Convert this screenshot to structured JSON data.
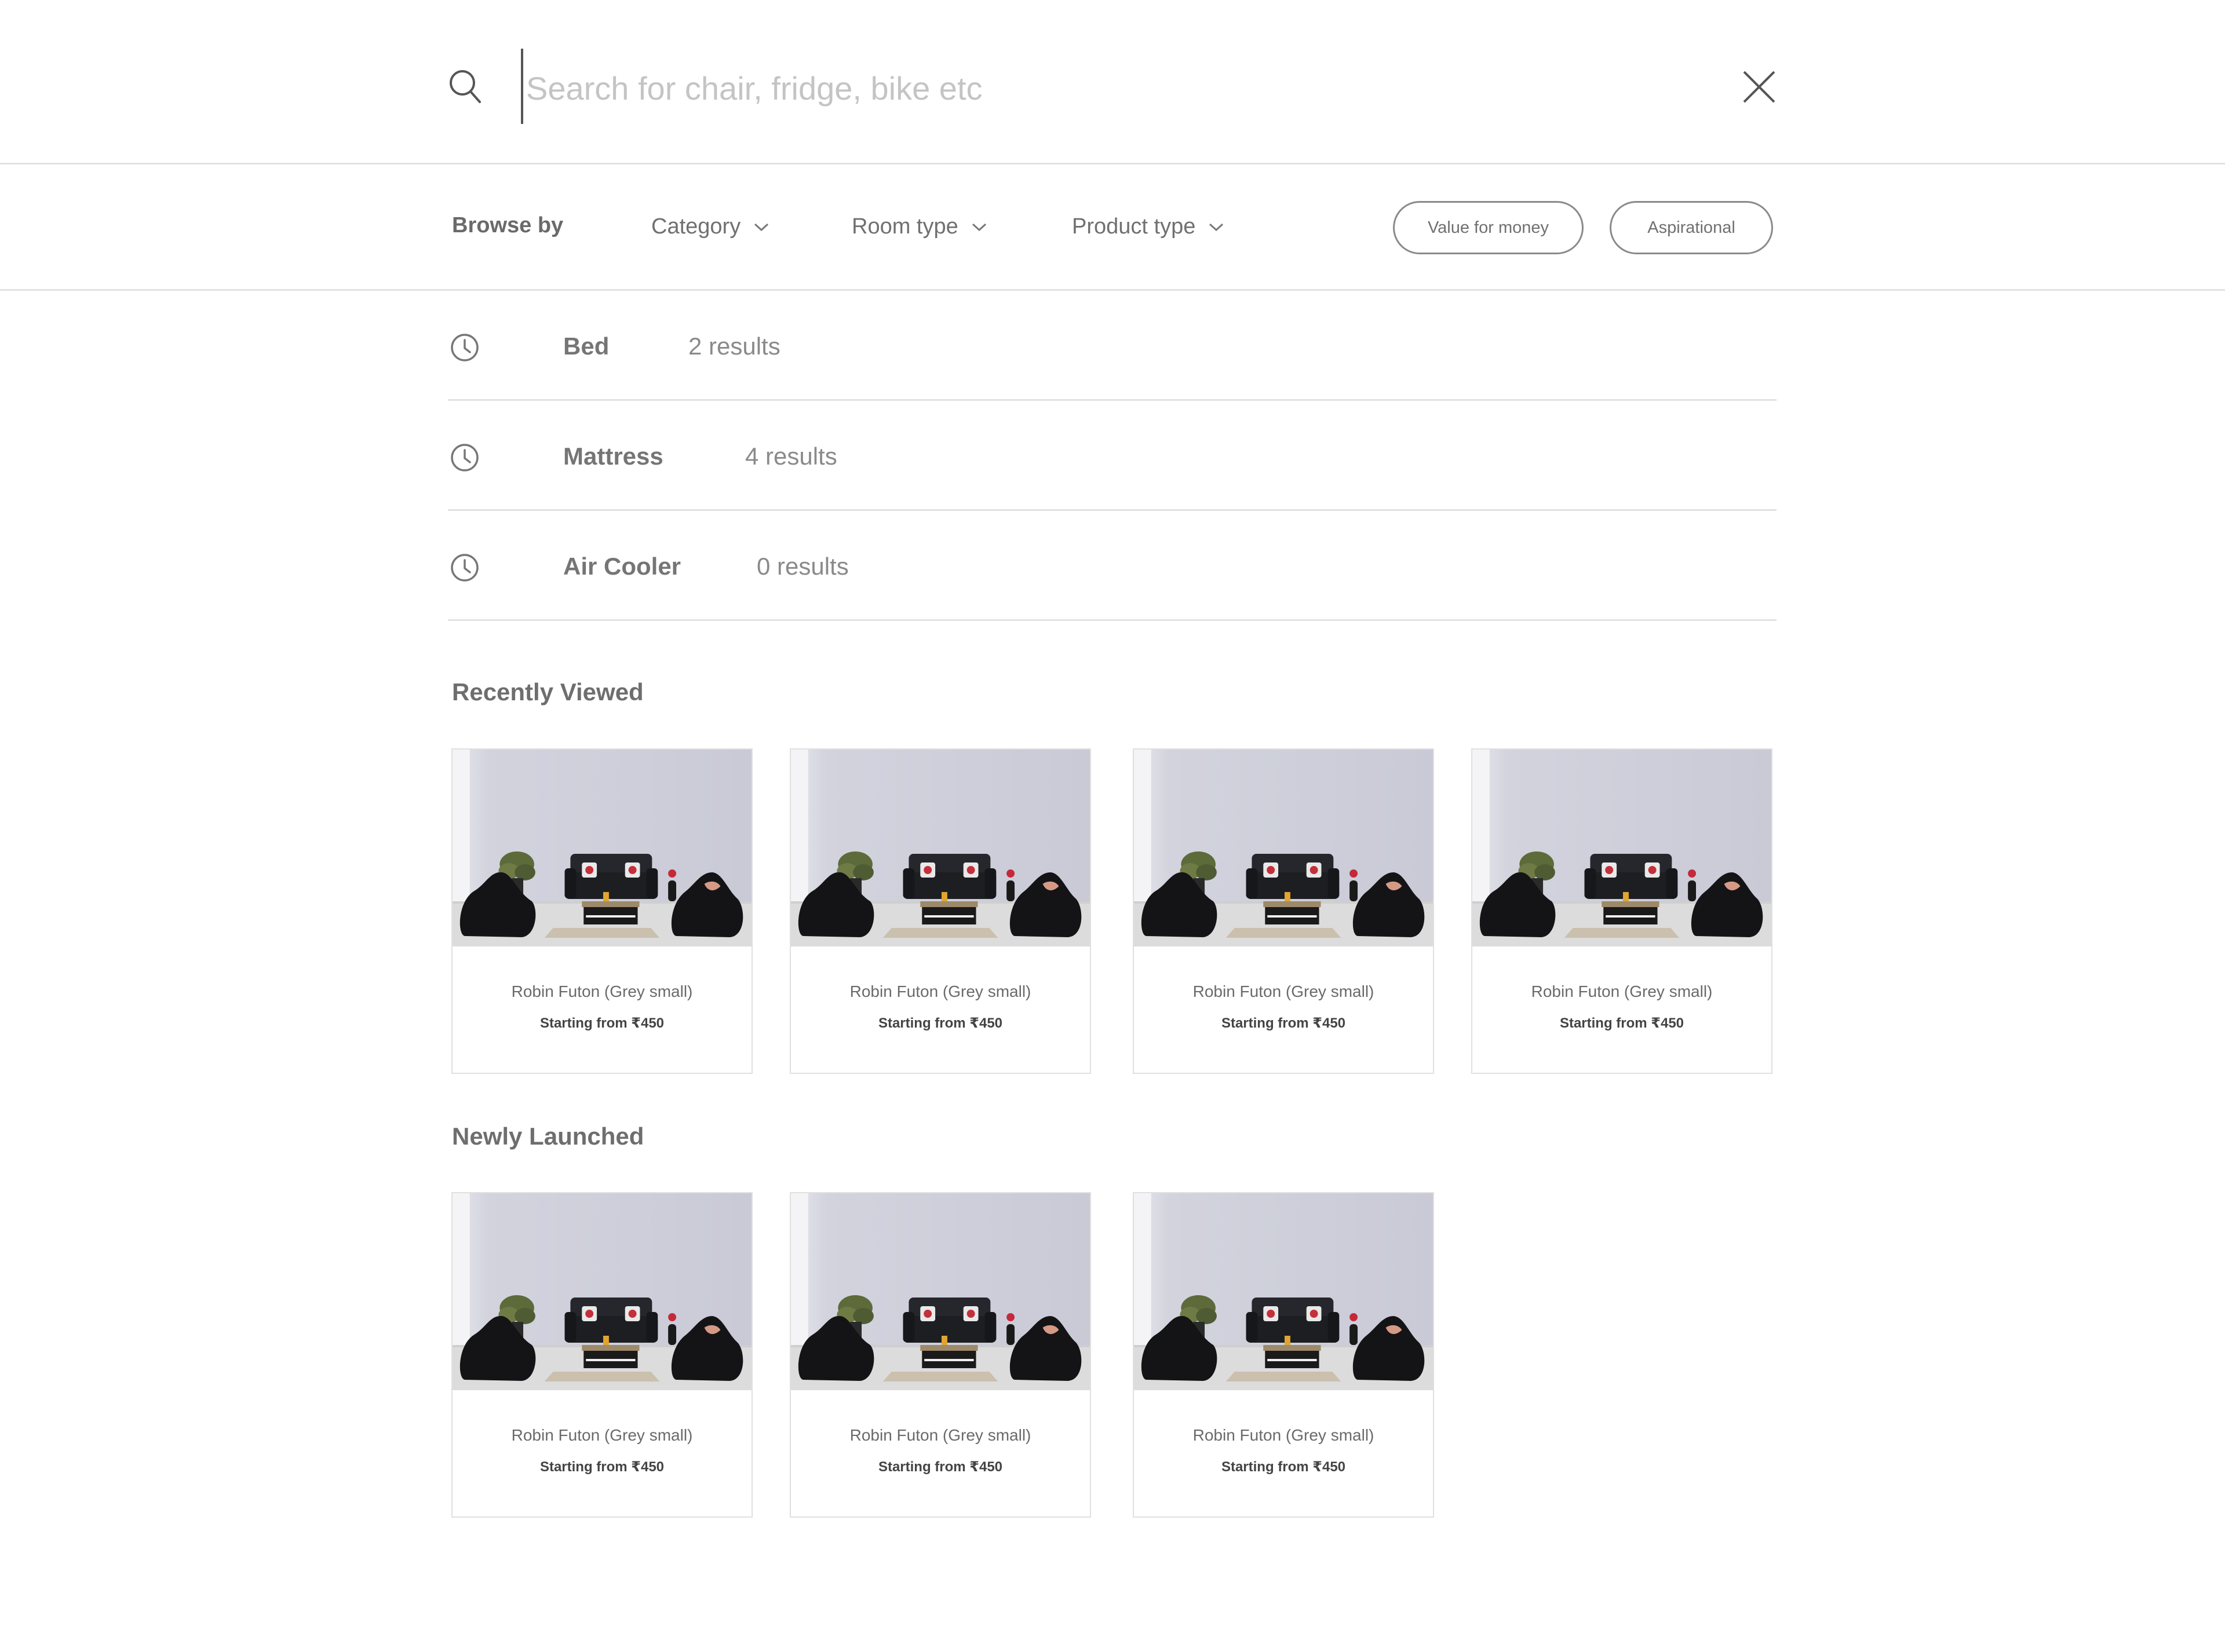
{
  "search": {
    "placeholder": "Search for chair, fridge, bike etc",
    "value": ""
  },
  "icons": {
    "search": "search-icon",
    "close": "close-icon",
    "chevron": "chevron-down-icon",
    "history": "clock-icon"
  },
  "browse": {
    "label": "Browse by",
    "dropdowns": [
      {
        "label": "Category"
      },
      {
        "label": "Room type"
      },
      {
        "label": "Product type"
      }
    ],
    "pills": [
      {
        "label": "Value for money"
      },
      {
        "label": "Aspirational"
      }
    ]
  },
  "recent_searches": [
    {
      "term": "Bed",
      "count": "2 results"
    },
    {
      "term": "Mattress",
      "count": "4 results"
    },
    {
      "term": "Air Cooler",
      "count": "0 results"
    }
  ],
  "recently_viewed": {
    "title": "Recently Viewed",
    "items": [
      {
        "name": "Robin Futon (Grey small)",
        "price": "Starting from ₹450"
      },
      {
        "name": "Robin Futon (Grey small)",
        "price": "Starting from ₹450"
      },
      {
        "name": "Robin Futon (Grey small)",
        "price": "Starting from ₹450"
      },
      {
        "name": "Robin Futon (Grey small)",
        "price": "Starting from ₹450"
      }
    ]
  },
  "newly_launched": {
    "title": "Newly Launched",
    "items": [
      {
        "name": "Robin Futon (Grey small)",
        "price": "Starting from ₹450"
      },
      {
        "name": "Robin Futon (Grey small)",
        "price": "Starting from ₹450"
      },
      {
        "name": "Robin Futon (Grey small)",
        "price": "Starting from ₹450"
      }
    ]
  },
  "colors": {
    "divider": "#e2e2e2",
    "text": "#6a6a6a",
    "placeholder": "#c4c4c4"
  }
}
